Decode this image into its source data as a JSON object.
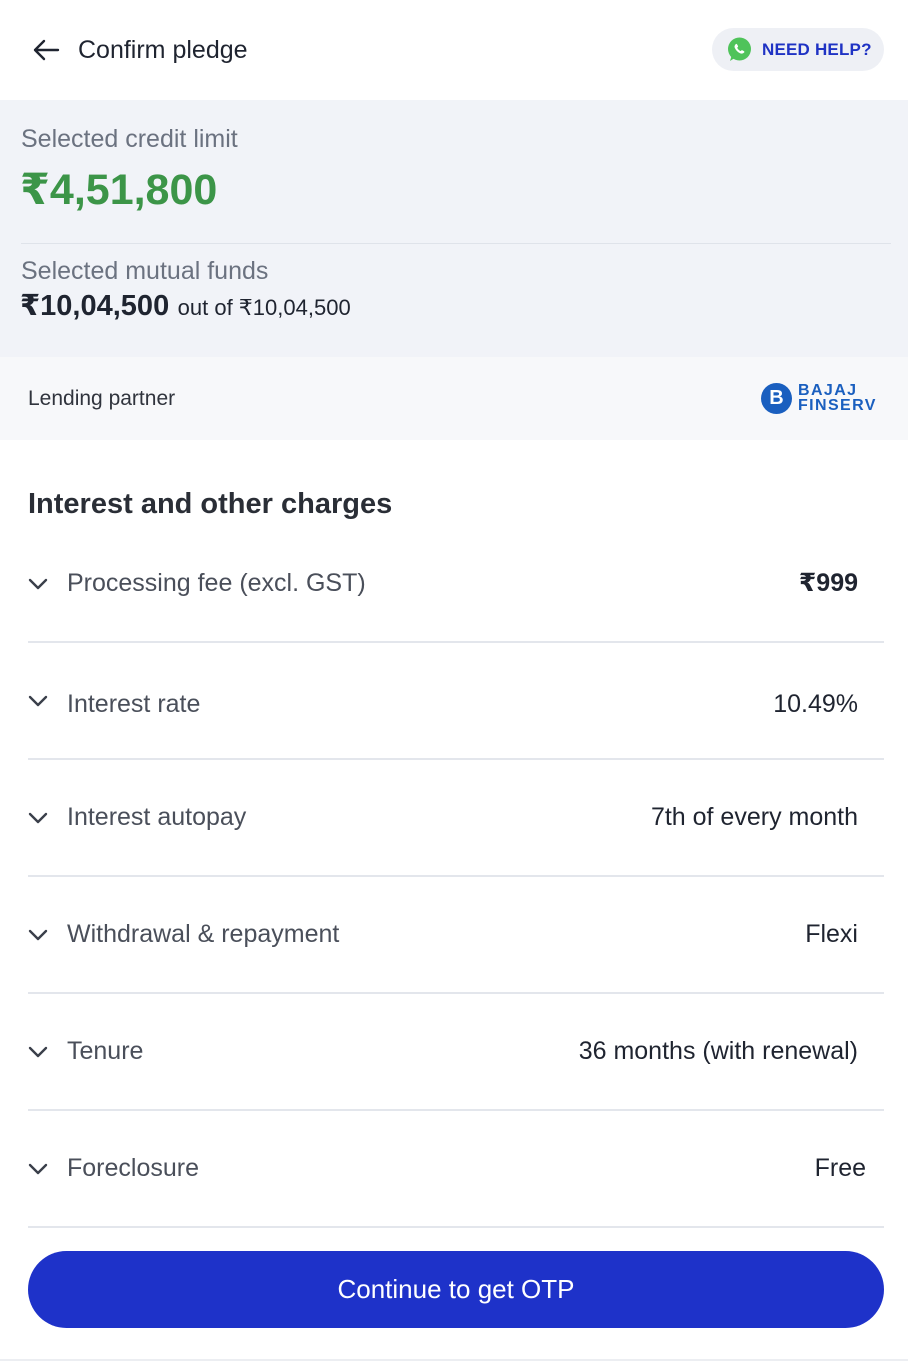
{
  "header": {
    "title": "Confirm pledge",
    "help_label": "NEED HELP?"
  },
  "summary": {
    "credit_label": "Selected credit limit",
    "credit_value": "₹4,51,800",
    "mf_label": "Selected mutual funds",
    "mf_selected": "₹10,04,500",
    "mf_out_of": "out of ₹10,04,500"
  },
  "partner": {
    "label": "Lending partner",
    "logo_mark": "B",
    "logo_line1": "BAJAJ",
    "logo_line2": "FINSERV"
  },
  "charges": {
    "title": "Interest and other charges",
    "rows": [
      {
        "label": "Processing fee (excl. GST)",
        "value": "₹999"
      },
      {
        "label": "Interest rate",
        "value": "10.49%"
      },
      {
        "label": "Interest autopay",
        "value": "7th of every month"
      },
      {
        "label": "Withdrawal & repayment",
        "value": "Flexi"
      },
      {
        "label": "Tenure",
        "value": "36 months (with renewal)"
      },
      {
        "label": "Foreclosure",
        "value": "Free"
      }
    ]
  },
  "cta": {
    "label": "Continue to get OTP"
  },
  "colors": {
    "accent": "#1e32c9",
    "credit_green": "#3c9548",
    "whatsapp_green": "#4fc35a",
    "bajaj_blue": "#1a5fbf"
  },
  "icons": {
    "back": "arrow-left-icon",
    "help": "whatsapp-icon",
    "row": "chevron-down-icon"
  }
}
